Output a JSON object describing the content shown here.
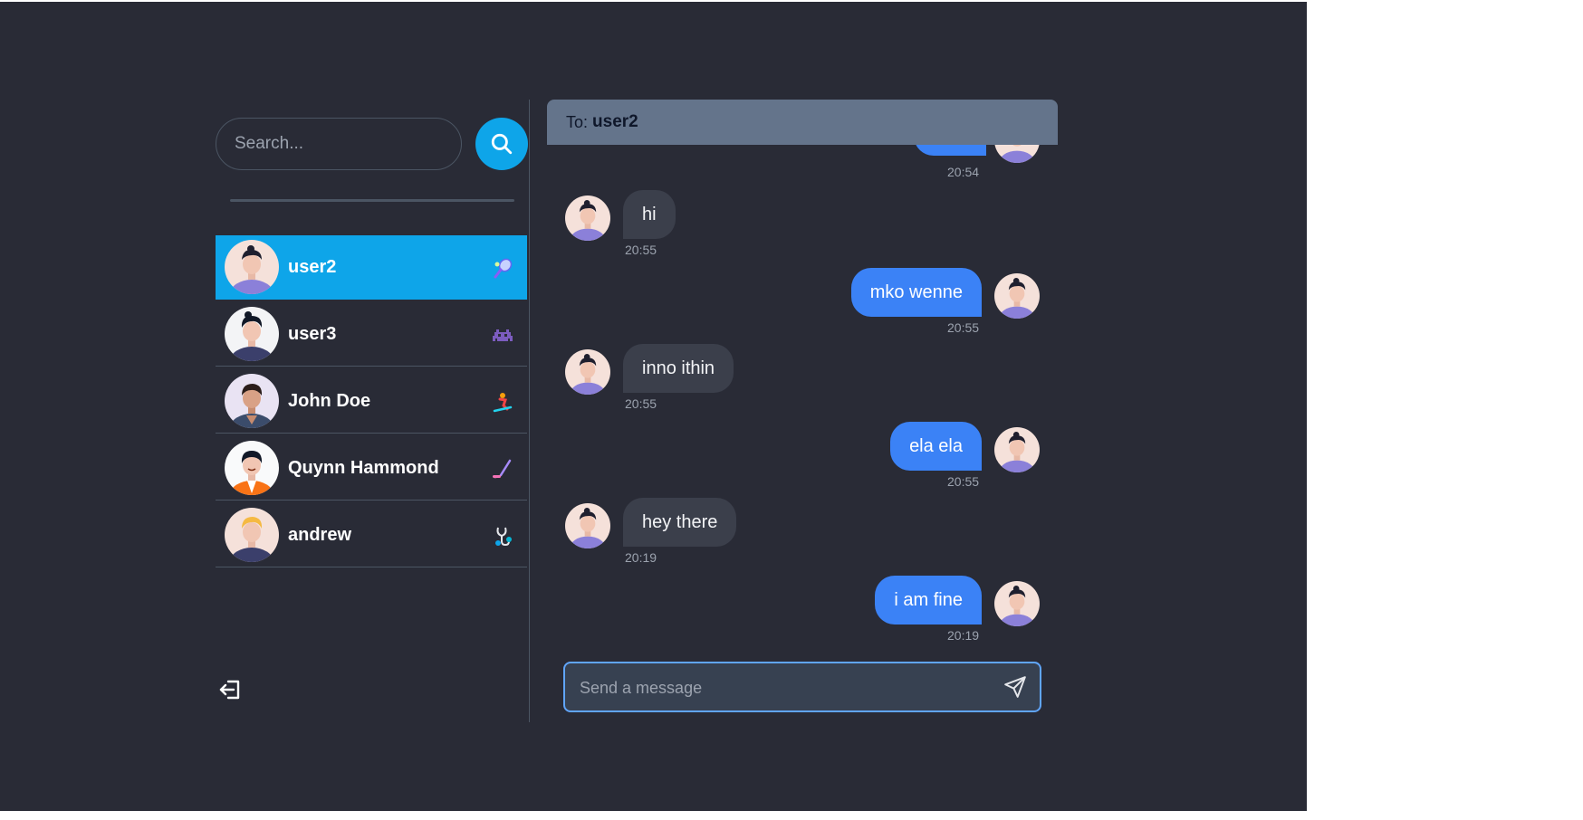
{
  "search": {
    "placeholder": "Search..."
  },
  "contacts": [
    {
      "name": "user2",
      "active": true,
      "status_icon": "tennis-racket-icon"
    },
    {
      "name": "user3",
      "active": false,
      "status_icon": "space-invader-icon"
    },
    {
      "name": "John Doe",
      "active": false,
      "status_icon": "snowboarder-icon"
    },
    {
      "name": "Quynn Hammond",
      "active": false,
      "status_icon": "hockey-stick-icon"
    },
    {
      "name": "andrew",
      "active": false,
      "status_icon": "stethoscope-icon"
    }
  ],
  "chat": {
    "to_label": "To:",
    "to_user": "user2",
    "messages": [
      {
        "side": "right",
        "text": "",
        "time": "20:54"
      },
      {
        "side": "left",
        "text": "hi",
        "time": "20:55"
      },
      {
        "side": "right",
        "text": "mko wenne",
        "time": "20:55"
      },
      {
        "side": "left",
        "text": "inno ithin",
        "time": "20:55"
      },
      {
        "side": "right",
        "text": "ela ela",
        "time": "20:55"
      },
      {
        "side": "left",
        "text": "hey there",
        "time": "20:19"
      },
      {
        "side": "right",
        "text": "i am fine",
        "time": "20:19"
      }
    ],
    "composer_placeholder": "Send a message"
  },
  "colors": {
    "background": "#292b36",
    "accent": "#0ea5e9",
    "sent_bubble": "#3b82f6",
    "received_bubble": "#3b3f4b",
    "header": "#64748b"
  }
}
